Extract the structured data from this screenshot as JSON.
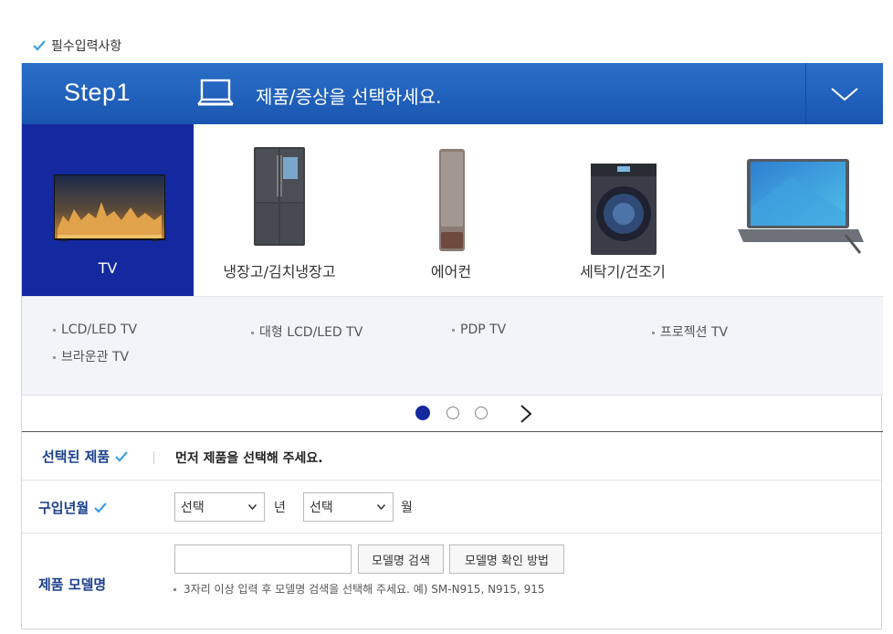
{
  "required_note": "필수입력사항",
  "step": {
    "title": "Step1",
    "description": "제품/증상을 선택하세요."
  },
  "categories": [
    {
      "label": "TV",
      "active": true
    },
    {
      "label": "냉장고/김치냉장고",
      "active": false
    },
    {
      "label": "에어컨",
      "active": false
    },
    {
      "label": "세탁기/건조기",
      "active": false
    },
    {
      "label": "",
      "active": false
    }
  ],
  "subcategories": [
    "LCD/LED TV",
    "대형 LCD/LED TV",
    "PDP TV",
    "프로젝션 TV",
    "브라운관 TV"
  ],
  "pagination": {
    "pages": 3,
    "current": 1
  },
  "selected_product": {
    "label": "선택된 제품",
    "message": "먼저 제품을 선택해 주세요."
  },
  "purchase_date": {
    "label": "구입년월",
    "year_select": "선택",
    "year_unit": "년",
    "month_select": "선택",
    "month_unit": "월"
  },
  "model": {
    "label": "제품 모델명",
    "input_value": "",
    "search_button": "모델명 검색",
    "howto_button": "모델명 확인 방법",
    "hint": "3자리 이상 입력 후 모델명 검색을 선택해 주세요. 예) SM-N915, N915, 915"
  },
  "colors": {
    "brand_blue": "#1428a0",
    "header_blue": "#1f5fbd",
    "check_blue": "#3aa0e0",
    "label_blue": "#1a3f8c"
  }
}
